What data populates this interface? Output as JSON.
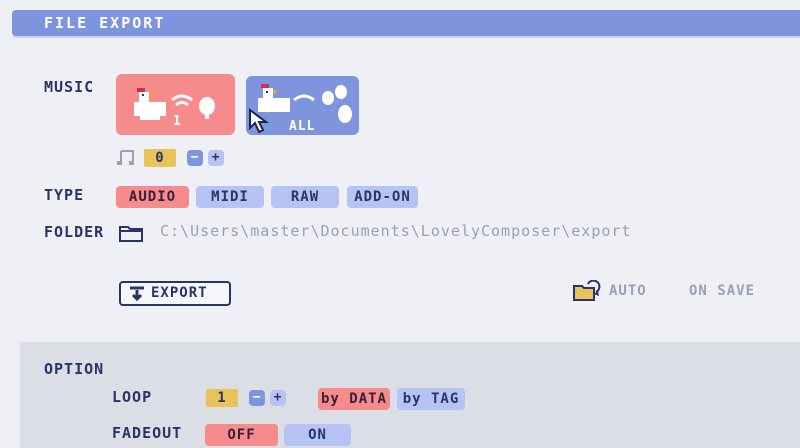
{
  "window": {
    "title": "FILE EXPORT"
  },
  "music": {
    "label": "MUSIC",
    "tiles": [
      {
        "caption": "1",
        "selected": true,
        "icon": "chicken-single-icon"
      },
      {
        "caption": "ALL",
        "selected": false,
        "icon": "chicken-all-icon"
      }
    ],
    "track_number": "0",
    "track_icon": "music-note-icon"
  },
  "type": {
    "label": "TYPE",
    "options": [
      "AUDIO",
      "MIDI",
      "RAW",
      "ADD-ON"
    ],
    "selected": "AUDIO"
  },
  "folder": {
    "label": "FOLDER",
    "path": "C:\\Users\\master\\Documents\\LovelyComposer\\export"
  },
  "export": {
    "button_label": "EXPORT",
    "auto_label": "AUTO",
    "on_save_label": "ON SAVE"
  },
  "option": {
    "title": "OPTION",
    "loop": {
      "label": "LOOP",
      "value": "1",
      "modes": [
        "by DATA",
        "by TAG"
      ],
      "selected": "by DATA"
    },
    "fadeout": {
      "label": "FADEOUT",
      "options": [
        "OFF",
        "ON"
      ],
      "selected": "OFF"
    }
  },
  "colors": {
    "accent": "#7e94dc",
    "selected": "#f58b8b",
    "unselected": "#b5c4f4",
    "number_bg": "#e7c35a",
    "text": "#2a3468",
    "muted_text": "#9aa0b4"
  }
}
